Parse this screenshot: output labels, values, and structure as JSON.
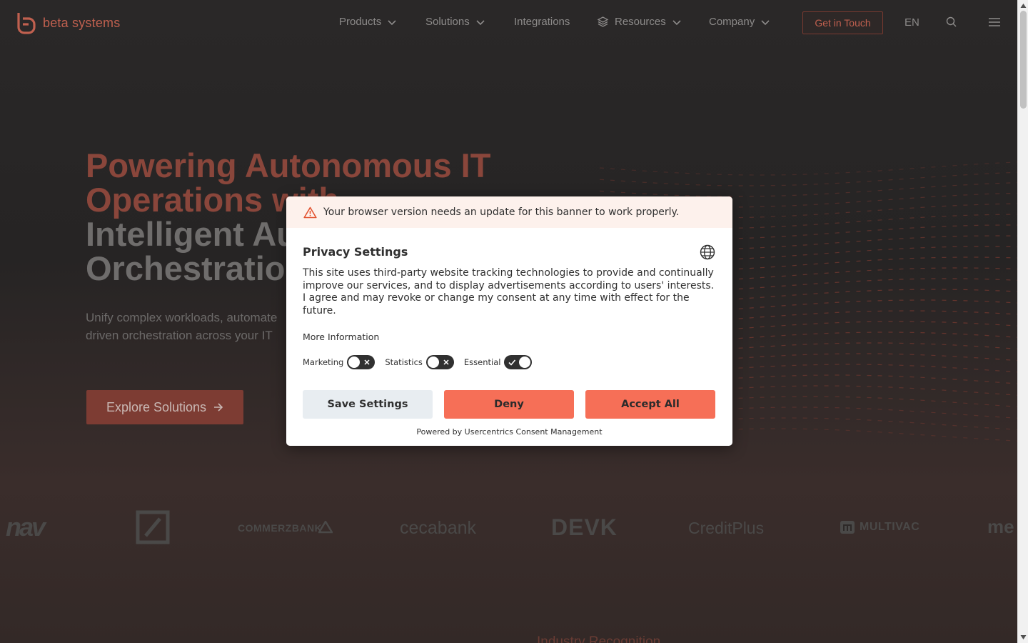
{
  "header": {
    "logo_text": "beta systems",
    "nav": [
      {
        "label": "Products",
        "has_dropdown": true
      },
      {
        "label": "Solutions",
        "has_dropdown": true
      },
      {
        "label": "Integrations",
        "has_dropdown": false
      },
      {
        "label": "Resources",
        "has_dropdown": true,
        "icon": "layers-icon"
      },
      {
        "label": "Company",
        "has_dropdown": true
      }
    ],
    "cta_label": "Get in Touch",
    "language": "EN",
    "icons": [
      "search-icon",
      "menu-icon"
    ]
  },
  "hero": {
    "title_line1": "Powering Autonomous IT",
    "title_line2": "Operations with",
    "title_line3": "Intelligent Au",
    "title_line4": "Orchestratio",
    "subtitle_line1": "Unify complex workloads, automate",
    "subtitle_line2": "driven orchestration across your IT",
    "button_label": "Explore Solutions"
  },
  "client_logos": [
    "nav",
    "",
    "COMMERZBANK",
    "cecabank",
    "DEVK",
    "CreditPlus",
    "MULTIVAC",
    "me"
  ],
  "next_section_title": "Industry Recognition",
  "consent": {
    "warning": "Your browser version needs an update for this banner to work properly.",
    "title": "Privacy Settings",
    "description": "This site uses third-party website tracking technologies to provide and continually improve our services, and to display advertisements according to users' interests. I agree and may revoke or change my consent at any time with effect for the future.",
    "more_info": "More Information",
    "toggles": [
      {
        "label": "Marketing",
        "on": false
      },
      {
        "label": "Statistics",
        "on": false
      },
      {
        "label": "Essential",
        "on": true
      }
    ],
    "buttons": {
      "save": "Save Settings",
      "deny": "Deny",
      "accept": "Accept All"
    },
    "powered_by": "Powered by Usercentrics Consent Management"
  },
  "colors": {
    "brand": "#c0604f",
    "consent_button": "#f66f57",
    "warning_bg": "#fdf1ec"
  }
}
